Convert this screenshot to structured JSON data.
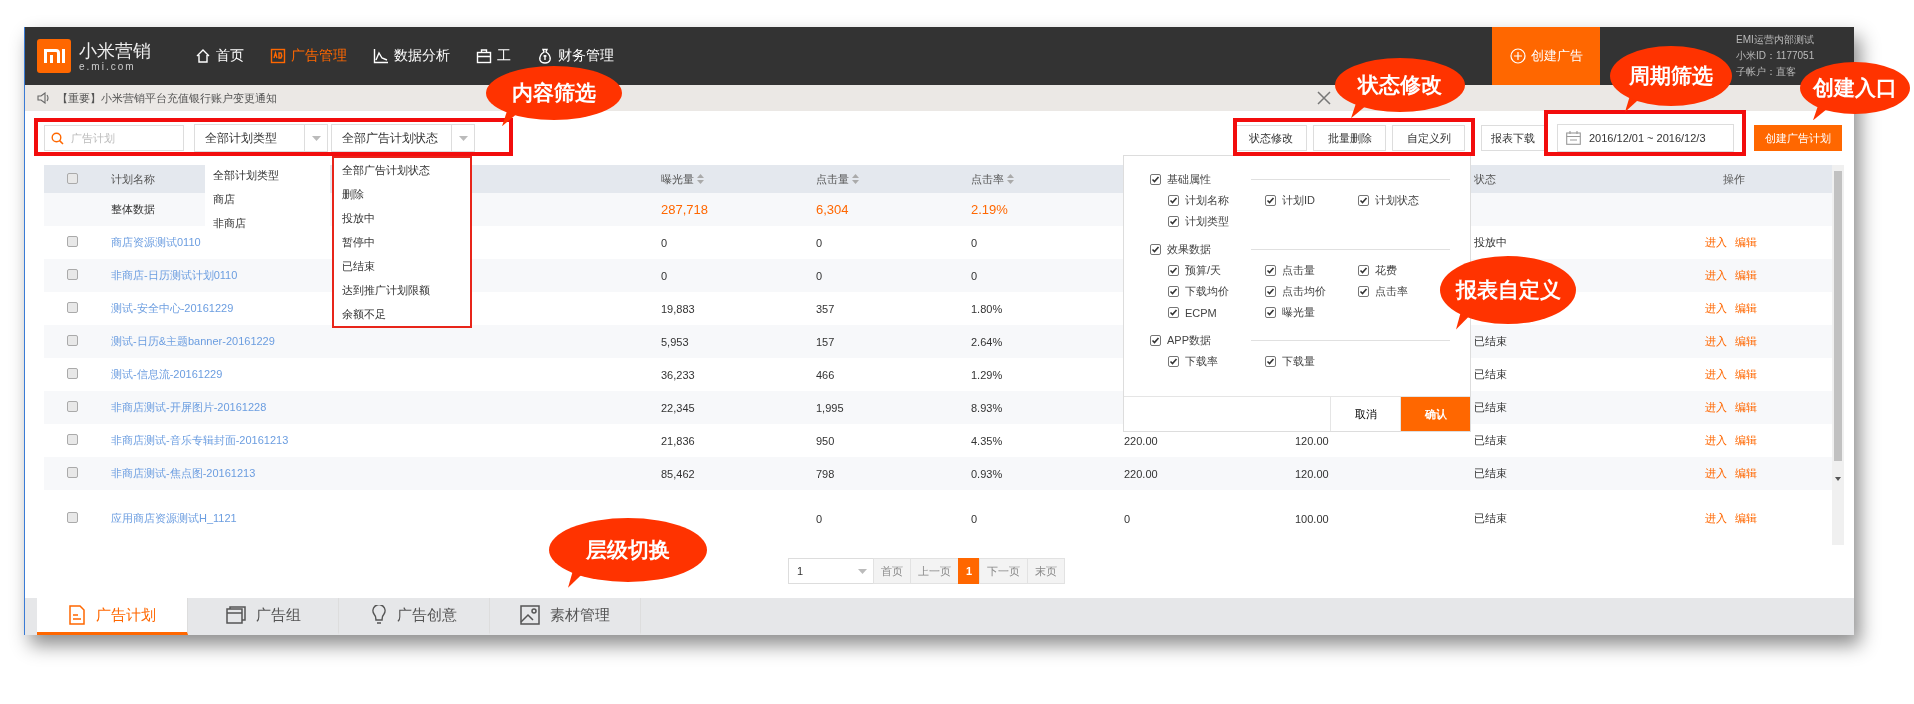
{
  "nav": {
    "brand": "小米营销",
    "domain": "e.mi.com",
    "items": [
      {
        "label": "首页",
        "selected": false
      },
      {
        "label": "广告管理",
        "selected": true
      },
      {
        "label": "数据分析",
        "selected": false
      },
      {
        "label": "工",
        "selected": false
      },
      {
        "label": "财务管理",
        "selected": false
      }
    ],
    "create_button": "创建广告",
    "user": [
      "EMI运营内部测试",
      "小米ID：1177051",
      "子帐户：直客"
    ]
  },
  "notice": {
    "text": "【重要】小米营销平台充值银行账户变更通知"
  },
  "toolbar": {
    "search": {
      "placeholder": "广告计划"
    },
    "selects": [
      "全部计划类型",
      "全部广告计划状态"
    ],
    "buttons": [
      "状态修改",
      "批量删除",
      "自定义列",
      "报表下载"
    ],
    "date_range": "2016/12/01 ~ 2016/12/3",
    "create_button": "创建广告计划"
  },
  "type_menu": [
    "全部计划类型",
    "商店",
    "非商店"
  ],
  "status_menu": [
    "全部广告计划状态",
    "删除",
    "投放中",
    "暂停中",
    "已结束",
    "达到推广计划限额",
    "余额不足"
  ],
  "table": {
    "header_checked": false,
    "columns": [
      {
        "label": "计划名称",
        "sortable": false
      },
      {
        "label": "曝光量",
        "sortable": true
      },
      {
        "label": "点击量",
        "sortable": true
      },
      {
        "label": "点击率",
        "sortable": true
      },
      {
        "label": "状态",
        "sortable": false
      },
      {
        "label": "操作",
        "sortable": false
      }
    ],
    "rows": [
      {
        "kind": "summary",
        "name": "整体数据",
        "impressions": "287,718",
        "clicks": "6,304",
        "ctr": "2.19%"
      },
      {
        "kind": "plan",
        "checked": false,
        "name": "商店资源测试0110",
        "impressions": "0",
        "clicks": "0",
        "ctr": "0",
        "status": "投放中",
        "actions": [
          "进入",
          "编辑"
        ]
      },
      {
        "kind": "plan",
        "checked": false,
        "name": "非商店-日历测试计划0110",
        "impressions": "0",
        "clicks": "0",
        "ctr": "0",
        "actions": [
          "进入",
          "编辑"
        ]
      },
      {
        "kind": "plan",
        "checked": false,
        "name": "测试-安全中心-20161229",
        "impressions": "19,883",
        "clicks": "357",
        "ctr": "1.80%",
        "actions": [
          "进入",
          "编辑"
        ]
      },
      {
        "kind": "plan",
        "checked": false,
        "name": "测试-日历&主题banner-20161229",
        "impressions": "5,953",
        "clicks": "157",
        "ctr": "2.64%",
        "status": "已结束",
        "actions": [
          "进入",
          "编辑"
        ]
      },
      {
        "kind": "plan",
        "checked": false,
        "name": "测试-信息流-20161229",
        "impressions": "36,233",
        "clicks": "466",
        "ctr": "1.29%",
        "status": "已结束",
        "actions": [
          "进入",
          "编辑"
        ]
      },
      {
        "kind": "plan",
        "checked": false,
        "name": "非商店测试-开屏图片-20161228",
        "impressions": "22,345",
        "clicks": "1,995",
        "ctr": "8.93%",
        "status": "已结束",
        "actions": [
          "进入",
          "编辑"
        ]
      },
      {
        "kind": "plan",
        "checked": false,
        "name": "非商店测试-音乐专辑封面-20161213",
        "impressions": "21,836",
        "clicks": "950",
        "ctr": "4.35%",
        "column_4": "220.00",
        "column_5": "120.00",
        "status": "已结束",
        "actions": [
          "进入",
          "编辑"
        ]
      },
      {
        "kind": "plan",
        "checked": false,
        "name": "非商店测试-焦点图-20161213",
        "impressions": "85,462",
        "clicks": "798",
        "ctr": "0.93%",
        "column_4": "220.00",
        "column_5": "120.00",
        "status": "已结束",
        "actions": [
          "进入",
          "编辑"
        ]
      },
      {
        "kind": "plan",
        "checked": false,
        "name": "应用商店资源测试H_1121",
        "clicks": "0",
        "ctr": "0",
        "column_4": "0",
        "column_5": "100.00",
        "status": "已结束",
        "actions": [
          "进入",
          "编辑"
        ]
      }
    ]
  },
  "column_menu": {
    "groups": [
      {
        "label": "基础属性",
        "checked": true,
        "options": [
          {
            "label": "计划名称",
            "checked": true
          },
          {
            "label": "计划ID",
            "checked": true
          },
          {
            "label": "计划状态",
            "checked": true
          },
          {
            "label": "计划类型",
            "checked": true
          }
        ]
      },
      {
        "label": "效果数据",
        "checked": true,
        "options": [
          {
            "label": "预算/天",
            "checked": true
          },
          {
            "label": "点击量",
            "checked": true
          },
          {
            "label": "花费",
            "checked": true
          },
          {
            "label": "下载均价",
            "checked": true
          },
          {
            "label": "点击均价",
            "checked": true
          },
          {
            "label": "点击率",
            "checked": true
          },
          {
            "label": "ECPM",
            "checked": true
          },
          {
            "label": "曝光量",
            "checked": true
          }
        ]
      },
      {
        "label": "APP数据",
        "checked": true,
        "options": [
          {
            "label": "下载率",
            "checked": true
          },
          {
            "label": "下载量",
            "checked": true
          }
        ]
      }
    ],
    "buttons": [
      "取消",
      "确认"
    ]
  },
  "pagination": {
    "page_select": "1",
    "pages": [
      {
        "label": "首页",
        "selected": false
      },
      {
        "label": "上一页",
        "selected": false
      },
      {
        "label": "1",
        "selected": true
      },
      {
        "label": "下一页",
        "selected": false
      },
      {
        "label": "末页",
        "selected": false
      }
    ]
  },
  "bottom_tabs": [
    {
      "label": "广告计划",
      "selected": true
    },
    {
      "label": "广告组",
      "selected": false
    },
    {
      "label": "广告创意",
      "selected": false
    },
    {
      "label": "素材管理",
      "selected": false
    }
  ],
  "callouts": [
    {
      "text": "内容筛选"
    },
    {
      "text": "状态修改"
    },
    {
      "text": "周期筛选"
    },
    {
      "text": "创建入口"
    },
    {
      "text": "报表自定义"
    },
    {
      "text": "层级切换"
    }
  ]
}
